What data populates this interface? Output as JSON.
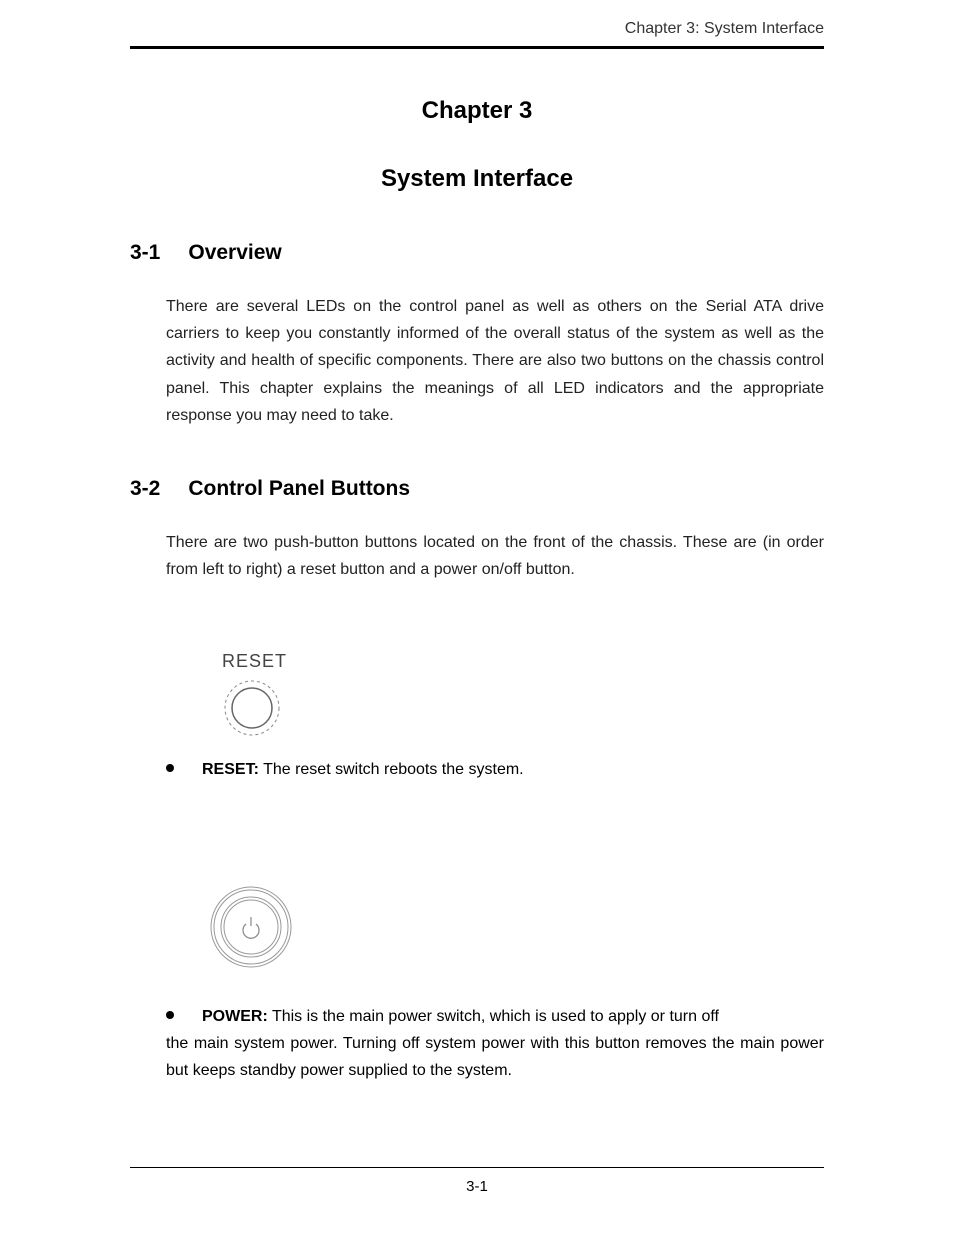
{
  "header": {
    "running_head": "Chapter 3: System Interface"
  },
  "chapter": {
    "number_label": "Chapter 3",
    "title": "System Interface"
  },
  "sections": {
    "s1": {
      "number": "3-1",
      "title": "Overview",
      "body": "There are several LEDs on the control panel as well as others on the Serial ATA drive carriers to keep you constantly informed of the overall status of the system as well as the activity and health of specific components.  There are also two buttons on the chassis control panel.  This chapter explains the meanings of all LED indicators and the appropriate response you may need to take."
    },
    "s2": {
      "number": "3-2",
      "title": "Control Panel Buttons",
      "body": "There are two push-button buttons located on the front of the chassis.  These are (in order from left to right) a reset button and a power on/off button.",
      "reset": {
        "icon_label": "RESET",
        "bullet_label": "RESET:",
        "bullet_text": "The reset switch reboots the system."
      },
      "power": {
        "bullet_label": "POWER:",
        "bullet_text_line1": "This is the main power switch, which is used to apply or turn off",
        "bullet_text_rest": "the main system power.  Turning off system power with this button removes the main power but keeps standby power supplied to the system."
      }
    }
  },
  "footer": {
    "page_number": "3-1"
  }
}
